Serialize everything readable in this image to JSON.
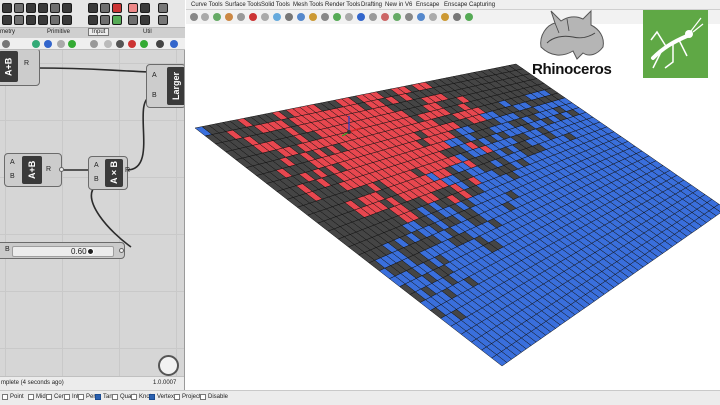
{
  "grasshopper": {
    "tabs": [
      "metry",
      "Primitive",
      "Input",
      "Util"
    ],
    "components": [
      {
        "name": "addition-top",
        "label": "A+B",
        "inputs": [],
        "output": "R"
      },
      {
        "name": "larger",
        "label": "Larger",
        "inputs": [
          "A",
          "B"
        ],
        "output": ""
      },
      {
        "name": "addition",
        "label": "A+B",
        "inputs": [
          "A",
          "B"
        ],
        "output": "R"
      },
      {
        "name": "multiplication",
        "label": "A×B",
        "inputs": [
          "A",
          "B"
        ],
        "output": "R"
      }
    ],
    "slider": {
      "label": "B",
      "value": "0.60",
      "fraction": 0.6
    },
    "status_left": "mplete (4 seconds ago)",
    "status_right": "1.0.0007"
  },
  "rhino": {
    "tabs": [
      "Curve Tools",
      "Surface Tools",
      "Solid Tools",
      "Mesh Tools",
      "Render Tools",
      "Drafting",
      "New in V6",
      "Enscape",
      "Enscape Capturing"
    ],
    "logo_text": "Rhinoceros",
    "colors": {
      "red": "#e8474f",
      "blue": "#3a6fdc",
      "dark": "#454545",
      "edge": "#111111"
    }
  },
  "osnap": [
    {
      "label": "Point",
      "checked": false
    },
    {
      "label": "Mid",
      "checked": false
    },
    {
      "label": "Cen",
      "checked": false
    },
    {
      "label": "Int",
      "checked": false
    },
    {
      "label": "Perp",
      "checked": false
    },
    {
      "label": "Tan",
      "checked": true
    },
    {
      "label": "Quad",
      "checked": false
    },
    {
      "label": "Knot",
      "checked": false
    },
    {
      "label": "Vertex",
      "checked": true
    },
    {
      "label": "Project",
      "checked": false
    },
    {
      "label": "Disable",
      "checked": false
    }
  ]
}
